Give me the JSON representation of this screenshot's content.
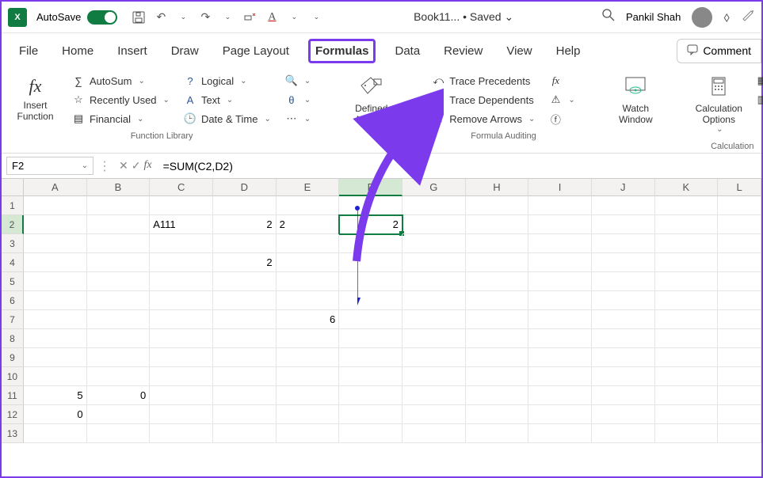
{
  "title": {
    "autosave": "AutoSave",
    "doc": "Book11...",
    "saved": "• Saved",
    "saved_caret": "⌄",
    "user": "Pankil Shah"
  },
  "tabs": [
    "File",
    "Home",
    "Insert",
    "Draw",
    "Page Layout",
    "Formulas",
    "Data",
    "Review",
    "View",
    "Help"
  ],
  "comment_btn": "Comment",
  "ribbon": {
    "insertfn": "Insert\nFunction",
    "funclib": {
      "autosum": "AutoSum",
      "recent": "Recently Used",
      "financial": "Financial",
      "logical": "Logical",
      "text": "Text",
      "datetime": "Date & Time",
      "caption": "Function Library"
    },
    "defnames": "Defined\nNames",
    "audit": {
      "trace_p": "Trace Precedents",
      "trace_d": "Trace Dependents",
      "remove": "Remove Arrows",
      "caption": "Formula Auditing"
    },
    "watch": "Watch\nWindow",
    "calc": {
      "opts": "Calculation\nOptions",
      "caption": "Calculation"
    }
  },
  "namebox": "F2",
  "formula": "=SUM(C2,D2)",
  "cols": [
    "A",
    "B",
    "C",
    "D",
    "E",
    "F",
    "G",
    "H",
    "I",
    "J",
    "K",
    "L"
  ],
  "rows": [
    1,
    2,
    3,
    4,
    5,
    6,
    7,
    8,
    9,
    10,
    11,
    12,
    13
  ],
  "cells": {
    "C2": "A111",
    "D2": "2",
    "E2": "2",
    "F2": "2",
    "D4": "2",
    "E7": "6",
    "A11": "5",
    "B11": "0",
    "A12": "0"
  },
  "active_cell": "F2",
  "left_align_cells": [
    "C2",
    "E2"
  ]
}
